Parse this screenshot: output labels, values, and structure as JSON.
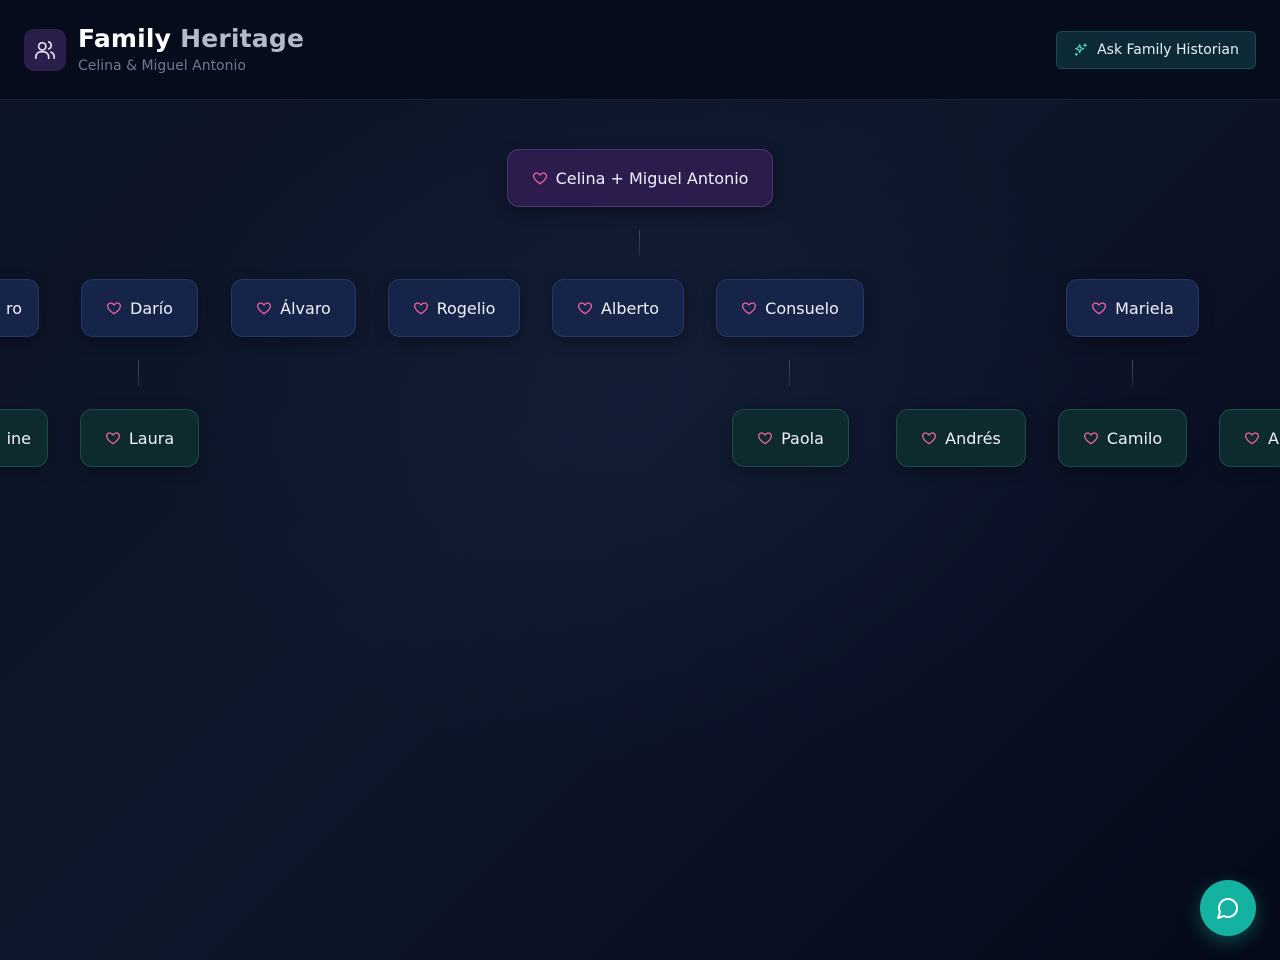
{
  "header": {
    "title_main": "Family",
    "title_accent": "Heritage",
    "subtitle": "Celina & Miguel Antonio",
    "ask_button": "Ask Family Historian",
    "icon": "users-icon"
  },
  "tree": {
    "root": "Celina + Miguel Antonio",
    "children": [
      "ro",
      "Darío",
      "Álvaro",
      "Rogelio",
      "Alberto",
      "Consuelo",
      "Mariela"
    ],
    "grandchildren": [
      "ine",
      "Laura",
      "Paola",
      "Andrés",
      "Camilo",
      "A"
    ]
  },
  "chat_fab": {
    "icon": "chat-bubble-icon"
  },
  "colors": {
    "accent": "#14b3a1",
    "heart": "#f0609e",
    "root_node": "#2c1c4e",
    "child_node": "#152448",
    "grandchild_node": "#0d2a2e"
  }
}
